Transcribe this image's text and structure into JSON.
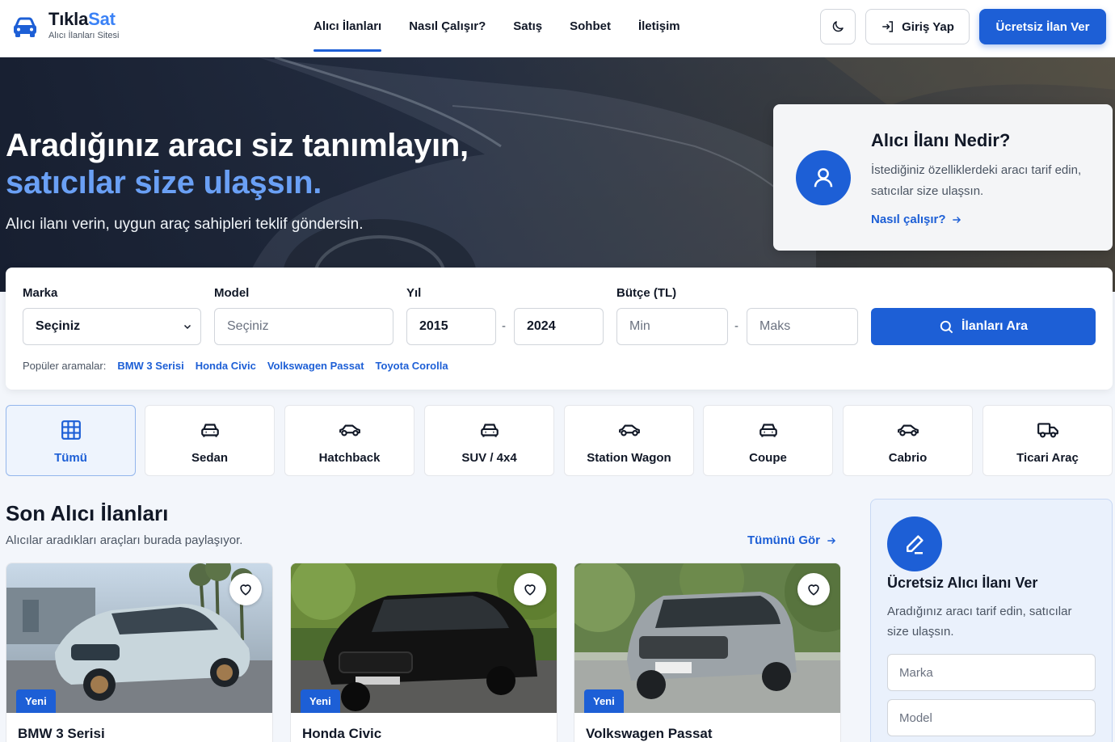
{
  "header": {
    "logo_title_part1": "Tıkla",
    "logo_title_part2": "Sat",
    "logo_subtitle": "Alıcı İlanları Sitesi",
    "nav": [
      "Alıcı İlanları",
      "Nasıl Çalışır?",
      "Satış",
      "Sohbet",
      "İletişim"
    ],
    "active_nav": "Alıcı İlanları",
    "theme_icon": "moon-icon",
    "login_label": "Giriş Yap",
    "cta_label": "Ücretsiz İlan Ver"
  },
  "hero": {
    "title_line1": "Aradığınız aracı siz tanımlayın,",
    "title_line2": "satıcılar size ulaşsın.",
    "subtitle": "Alıcı ilanı verin, uygun araç sahipleri teklif göndersin."
  },
  "info_card": {
    "title": "Alıcı İlanı Nedir?",
    "text": "İstediğiniz özelliklerdeki aracı tarif edin, satıcılar size ulaşsın.",
    "link": "Nasıl çalışır?"
  },
  "search": {
    "brand_label": "Marka",
    "brand_value": "Seçiniz",
    "model_label": "Model",
    "model_placeholder": "Seçiniz",
    "year_label": "Yıl",
    "year_from": "2015",
    "year_to": "2024",
    "budget_label": "Bütçe (TL)",
    "budget_min_placeholder": "Min",
    "budget_max_placeholder": "Maks",
    "dash": "-",
    "button_label": "İlanları Ara",
    "popular_label": "Popüler aramalar:",
    "popular": [
      "BMW 3 Serisi",
      "Honda Civic",
      "Volkswagen Passat",
      "Toyota Corolla"
    ]
  },
  "categories": [
    {
      "label": "Tümü",
      "icon": "grid-icon",
      "active": true
    },
    {
      "label": "Sedan",
      "icon": "car-front-icon"
    },
    {
      "label": "Hatchback",
      "icon": "car-side-icon"
    },
    {
      "label": "SUV / 4x4",
      "icon": "car-front-icon"
    },
    {
      "label": "Station Wagon",
      "icon": "car-side-icon"
    },
    {
      "label": "Coupe",
      "icon": "car-front-icon"
    },
    {
      "label": "Cabrio",
      "icon": "car-side-icon"
    },
    {
      "label": "Ticari Araç",
      "icon": "truck-icon"
    }
  ],
  "listings": {
    "title": "Son Alıcı İlanları",
    "subtitle": "Alıcılar aradıkları araçları burada paylaşıyor.",
    "see_all": "Tümünü Gör",
    "items": [
      {
        "title": "BMW 3 Serisi",
        "badge": "Yeni",
        "color": "#c8d6dc"
      },
      {
        "title": "Honda Civic",
        "badge": "Yeni",
        "color": "#111111"
      },
      {
        "title": "Volkswagen Passat",
        "badge": "Yeni",
        "color": "#9ca3a8"
      }
    ]
  },
  "side_form": {
    "title": "Ücretsiz Alıcı İlanı Ver",
    "text": "Aradığınız aracı tarif edin, satıcılar size ulaşsın.",
    "brand_placeholder": "Marka",
    "model_placeholder": "Model"
  },
  "colors": {
    "primary": "#1d5fd6",
    "accent_light": "#6aa0f5"
  }
}
